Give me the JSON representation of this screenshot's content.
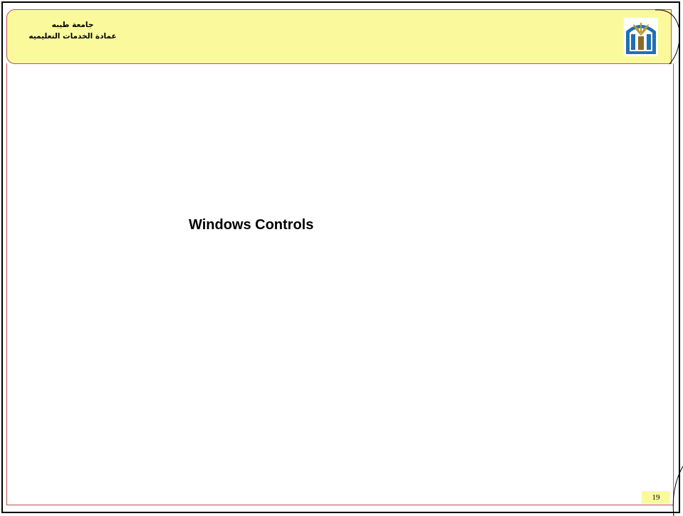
{
  "header": {
    "line1": "جامعة طيبه",
    "line2": "عمادة الخدمات التعليميه",
    "background_color": "#fafa9c",
    "border_color": "#c0504d",
    "logo_icon": "taibah-university-logo-icon"
  },
  "slide": {
    "title": "Windows Controls",
    "page_number": "19"
  }
}
